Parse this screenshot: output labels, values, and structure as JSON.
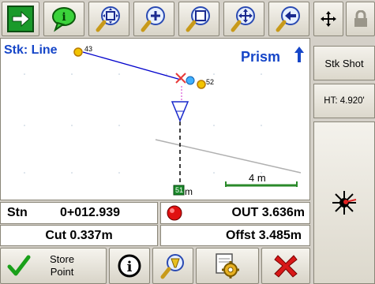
{
  "toolbar": {
    "items": [
      {
        "name": "go-arrow-icon"
      },
      {
        "name": "info-bubble-icon"
      },
      {
        "name": "zoom-extents-icon"
      },
      {
        "name": "zoom-in-icon"
      },
      {
        "name": "zoom-window-icon"
      },
      {
        "name": "pan-icon"
      },
      {
        "name": "zoom-previous-icon"
      },
      {
        "name": "move-cross-icon"
      },
      {
        "name": "lock-icon"
      }
    ]
  },
  "map": {
    "title": "Stk: Line",
    "target_label": "Prism",
    "points": {
      "start": "43",
      "current": "52",
      "end": "51"
    },
    "end_unit": "m",
    "scale_label": "4 m",
    "colors": {
      "line": "#0000cc",
      "accent": "#1646c8",
      "point": "#f2c400",
      "cross": "#e63a3a"
    }
  },
  "side_panel": {
    "stake_shot": "Stk Shot",
    "height": "HT: 4.920'"
  },
  "stats": {
    "stn_label": "Stn",
    "stn_value": "0+012.939",
    "out_value": "OUT 3.636m",
    "cut_value": "Cut 0.337m",
    "offset_value": "Offst 3.485m"
  },
  "bottom_bar": {
    "store_line1": "Store",
    "store_line2": "Point"
  }
}
